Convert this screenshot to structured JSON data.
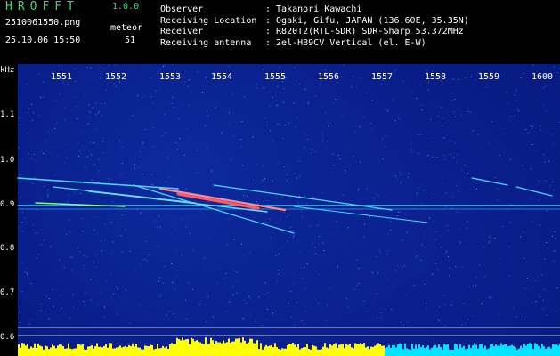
{
  "app": {
    "title": "HROFFT",
    "version": "1.0.0"
  },
  "capture": {
    "filename": "2510061550.png",
    "timestamp": "25.10.06 15:50",
    "meteor_label": "meteor",
    "meteor_count": "51"
  },
  "info": [
    {
      "label": "Observer",
      "value": ": Takanori Kawachi"
    },
    {
      "label": "Receiving Location",
      "value": ": Ogaki, Gifu, JAPAN (136.60E, 35.35N)"
    },
    {
      "label": "Receiver",
      "value": ": R820T2(RTL-SDR) SDR-Sharp 53.372MHz"
    },
    {
      "label": "Receiving antenna",
      "value": ": 2el-HB9CV Vertical (el. E-W)"
    }
  ],
  "axes": {
    "y_unit": "kHz",
    "y_ticks": [
      "1.1",
      "1.0",
      "0.9",
      "0.8",
      "0.7",
      "0.6"
    ],
    "x_ticks": [
      "1551",
      "1552",
      "1553",
      "1554",
      "1555",
      "1556",
      "1557",
      "1558",
      "1559",
      "1600"
    ]
  },
  "colors": {
    "background": "#071a82",
    "trail": "#4fd6ff",
    "accent": "#2ee06a",
    "activity": "#ffff00",
    "baseline": "#00e5ff"
  }
}
